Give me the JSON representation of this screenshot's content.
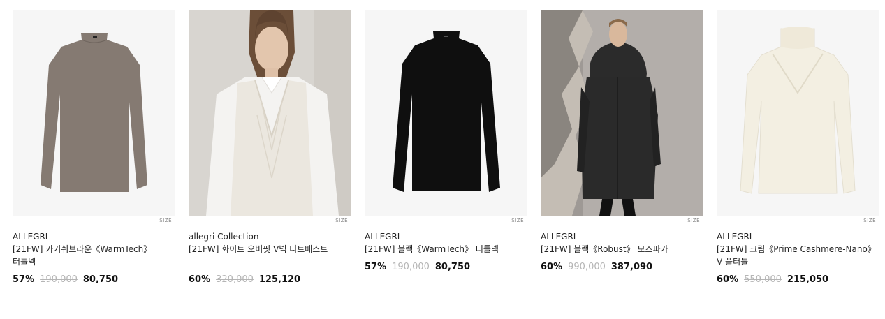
{
  "size_label": "SIZE",
  "products": [
    {
      "brand": "ALLEGRI",
      "name": "[21FW] 카키쉬브라운《WarmTech》 터틀넥",
      "discount": "57%",
      "original_price": "190,000",
      "sale_price": "80,750",
      "image": "khaki-brown-turtleneck-image"
    },
    {
      "brand": "allegri Collection",
      "name": "[21FW] 화이트 오버핏 V넥 니트베스트",
      "discount": "60%",
      "original_price": "320,000",
      "sale_price": "125,120",
      "image": "white-knit-vest-model-image"
    },
    {
      "brand": "ALLEGRI",
      "name": "[21FW] 블랙《WarmTech》 터틀넥",
      "discount": "57%",
      "original_price": "190,000",
      "sale_price": "80,750",
      "image": "black-turtleneck-image"
    },
    {
      "brand": "ALLEGRI",
      "name": "[21FW] 블랙《Robust》 모즈파카",
      "discount": "60%",
      "original_price": "990,000",
      "sale_price": "387,090",
      "image": "black-mods-parka-model-image"
    },
    {
      "brand": "ALLEGRI",
      "name": "[21FW] 크림《Prime Cashmere-Nano》 V 풀터틀",
      "discount": "60%",
      "original_price": "550,000",
      "sale_price": "215,050",
      "image": "cream-cashmere-pullover-image"
    }
  ]
}
